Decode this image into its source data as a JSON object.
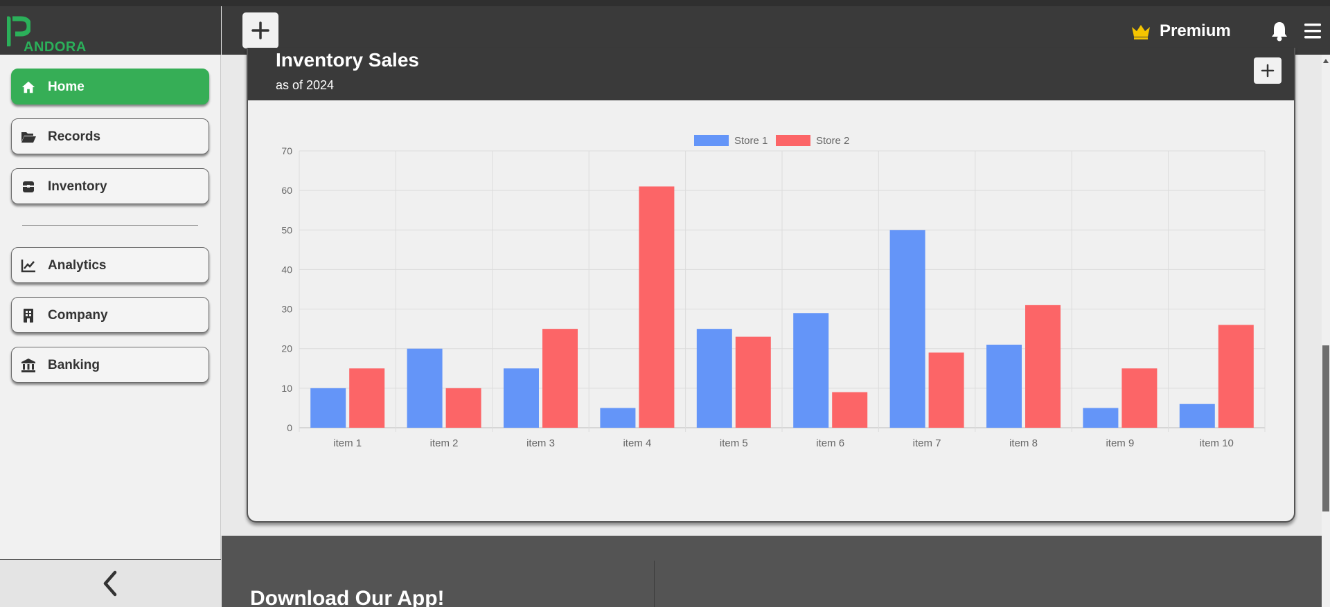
{
  "brand": {
    "logo_text": "ANDORA"
  },
  "sidebar": {
    "items": [
      {
        "label": "Home",
        "icon": "home-icon",
        "active": true
      },
      {
        "label": "Records",
        "icon": "folder-open-icon"
      },
      {
        "label": "Inventory",
        "icon": "box-icon"
      },
      {
        "label": "Analytics",
        "icon": "chart-line-icon"
      },
      {
        "label": "Company",
        "icon": "building-icon"
      },
      {
        "label": "Banking",
        "icon": "bank-icon"
      }
    ],
    "collapse_icon": "chevron-left-icon"
  },
  "header": {
    "add_icon": "plus-icon",
    "premium_label": "Premium",
    "premium_icon": "crown-icon",
    "notification_icon": "bell-icon",
    "menu_icon": "hamburger-icon"
  },
  "card": {
    "title": "Inventory Sales",
    "subtitle": "as of 2024",
    "action_icon": "plus-icon"
  },
  "chart_data": {
    "type": "bar",
    "categories": [
      "item 1",
      "item 2",
      "item 3",
      "item 4",
      "item 5",
      "item 6",
      "item 7",
      "item 8",
      "item 9",
      "item 10"
    ],
    "series": [
      {
        "name": "Store 1",
        "color": "#6495f8",
        "values": [
          10,
          20,
          15,
          5,
          25,
          29,
          50,
          21,
          5,
          6
        ]
      },
      {
        "name": "Store 2",
        "color": "#fc6567",
        "values": [
          15,
          10,
          25,
          61,
          23,
          9,
          19,
          31,
          15,
          26
        ]
      }
    ],
    "yticks": [
      0,
      10,
      20,
      30,
      40,
      50,
      60,
      70
    ],
    "ylim": [
      0,
      70
    ],
    "grid": true,
    "legend_position": "top-center"
  },
  "footer": {
    "title": "Download Our App!"
  },
  "colors": {
    "accent": "#36ae56",
    "header": "#3a3a3a",
    "premium": "#f5c400"
  }
}
